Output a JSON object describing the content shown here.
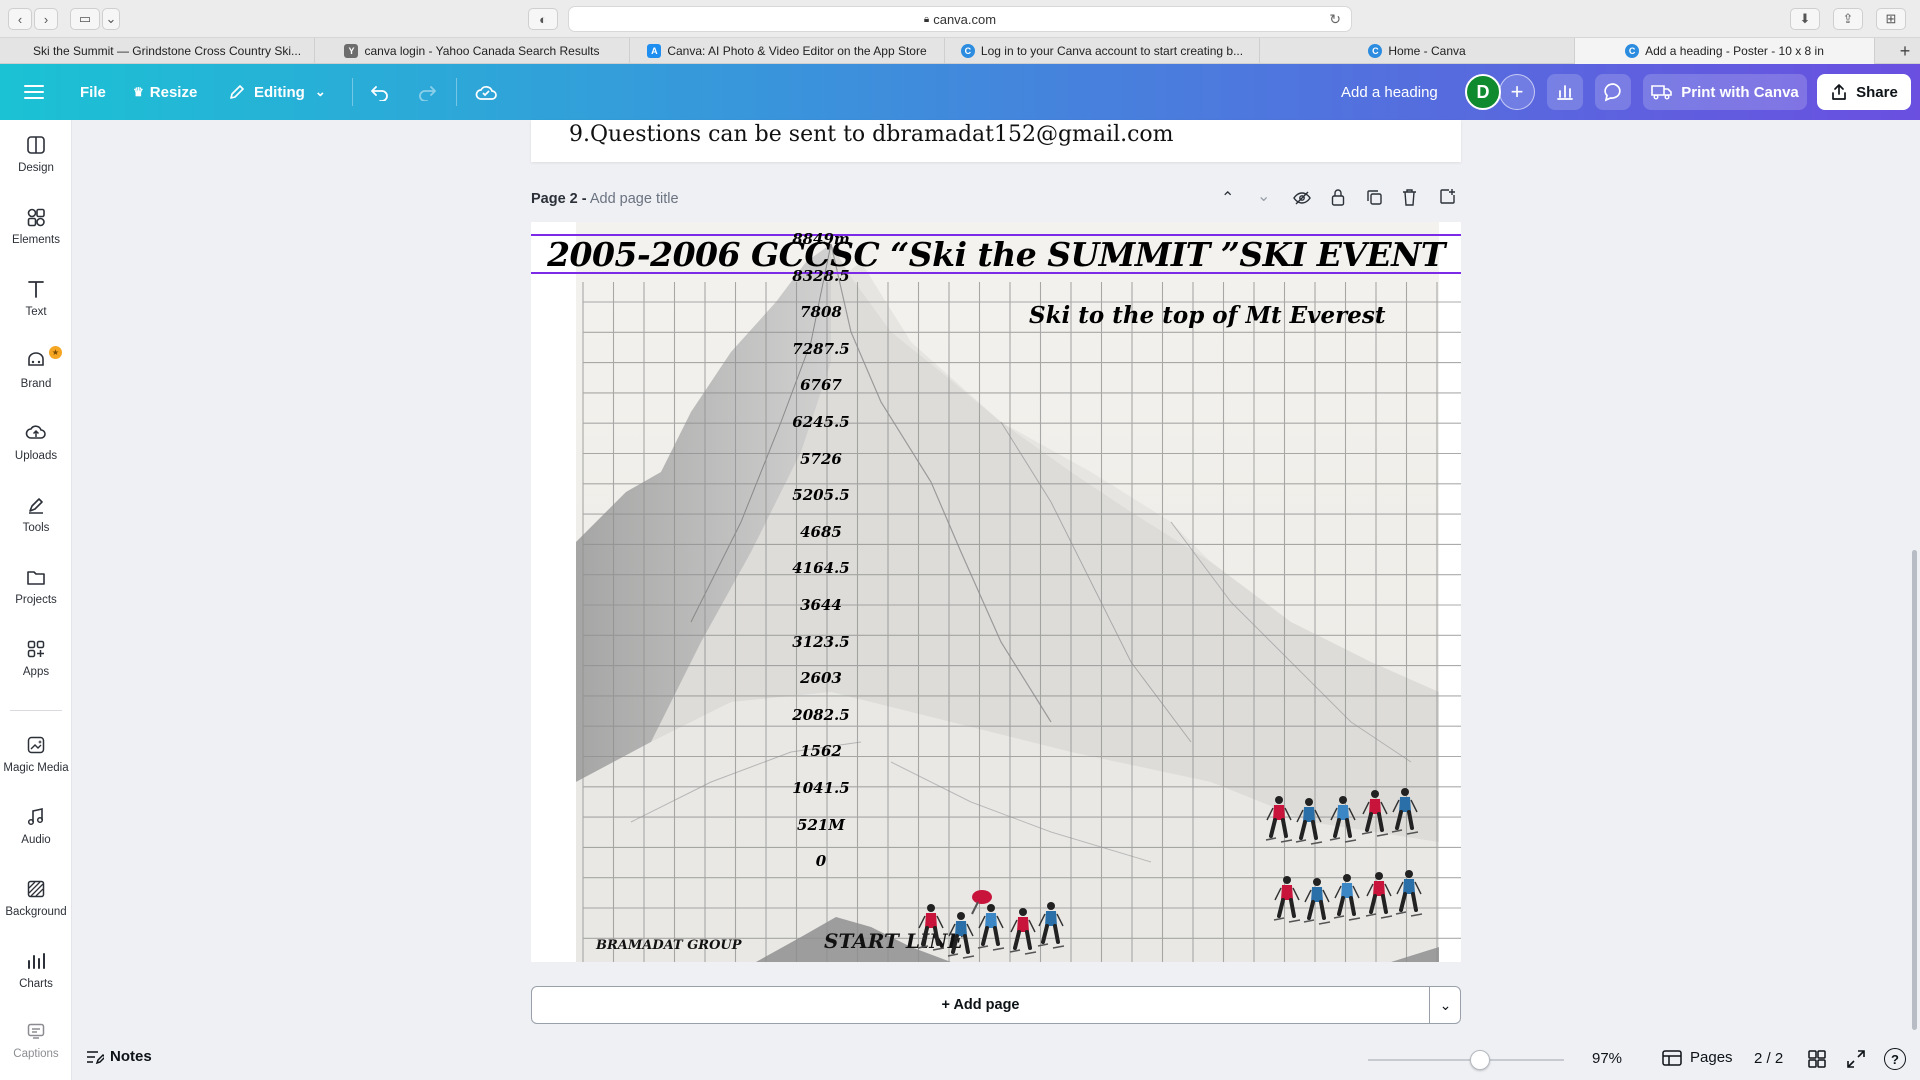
{
  "browser": {
    "url": "canva.com",
    "tabs": [
      {
        "title": "Ski the Summit — Grindstone Cross Country Ski...",
        "icon": "page-icon"
      },
      {
        "title": "canva login - Yahoo Canada Search Results",
        "icon": "yahoo-icon"
      },
      {
        "title": "Canva: AI Photo & Video Editor on the App Store",
        "icon": "appstore-icon"
      },
      {
        "title": "Log in to your Canva account to start creating b...",
        "icon": "canva-icon"
      },
      {
        "title": "Home - Canva",
        "icon": "canva-icon"
      },
      {
        "title": "Add a heading - Poster - 10 x 8 in",
        "icon": "canva-icon"
      }
    ]
  },
  "header": {
    "file_label": "File",
    "resize_label": "Resize",
    "editing_label": "Editing",
    "doc_title": "Add a heading",
    "avatar_letter": "D",
    "print_label": "Print with Canva",
    "share_label": "Share"
  },
  "sidebar": {
    "items": [
      {
        "label": "Design",
        "icon": "design-icon"
      },
      {
        "label": "Elements",
        "icon": "elements-icon"
      },
      {
        "label": "Text",
        "icon": "text-icon"
      },
      {
        "label": "Brand",
        "icon": "brand-icon"
      },
      {
        "label": "Uploads",
        "icon": "uploads-icon"
      },
      {
        "label": "Tools",
        "icon": "tools-icon"
      },
      {
        "label": "Projects",
        "icon": "projects-icon"
      },
      {
        "label": "Apps",
        "icon": "apps-icon"
      },
      {
        "label": "Magic Media",
        "icon": "magic-media-icon"
      },
      {
        "label": "Audio",
        "icon": "audio-icon"
      },
      {
        "label": "Background",
        "icon": "background-icon"
      },
      {
        "label": "Charts",
        "icon": "charts-icon"
      },
      {
        "label": "Captions",
        "icon": "captions-icon"
      }
    ]
  },
  "prev_page": {
    "last_line": "9.Questions can be sent to dbramadat152@gmail.com"
  },
  "page2": {
    "label": "Page 2 -",
    "title_placeholder": "Add page title"
  },
  "poster": {
    "heading": "2005-2006 GCCSC “Ski the SUMMIT ”SKI EVENT",
    "subtitle": "Ski to the top of Mt Everest",
    "elevations": [
      "8849m",
      "8328.5",
      "7808",
      "7287.5",
      "6767",
      "6245.5",
      "5726",
      "5205.5",
      "4685",
      "4164.5",
      "3644",
      "3123.5",
      "2603",
      "2082.5",
      "1562",
      "1041.5",
      "521M",
      "0"
    ],
    "start_label": "START LINE",
    "group_label": "BRAMADAT GROUP"
  },
  "add_page_label": "+ Add page",
  "footer": {
    "notes_label": "Notes",
    "zoom": "97%",
    "pages_label": "Pages",
    "page_count": "2 / 2",
    "zoom_fraction": 0.57
  },
  "colors": {
    "accent": "#7d2ae8",
    "header_start": "#1bc2d4",
    "header_end": "#6a4fe0",
    "avatar": "#0f8a2f",
    "brand_badge": "#f5a623"
  }
}
